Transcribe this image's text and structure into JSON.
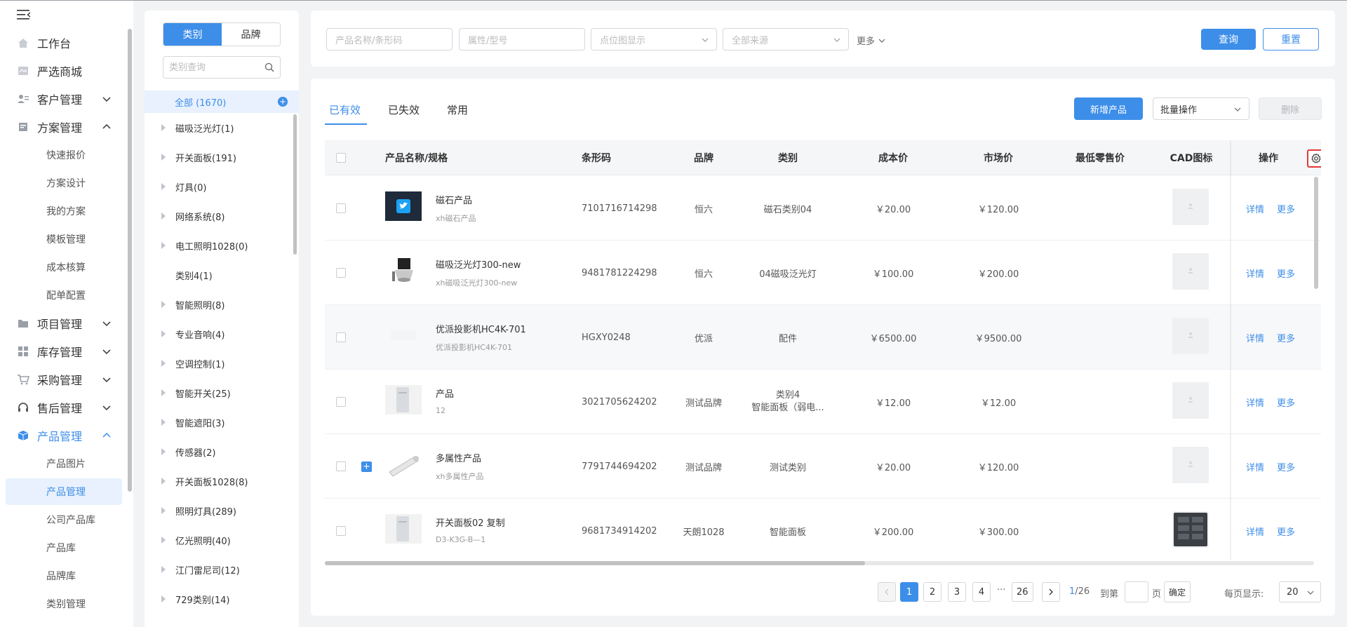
{
  "sidebar": {
    "items": [
      {
        "label": "工作台",
        "icon": "home-icon"
      },
      {
        "label": "严选商城",
        "icon": "mall-icon"
      },
      {
        "label": "客户管理",
        "icon": "customer-icon"
      },
      {
        "label": "方案管理",
        "icon": "plan-icon"
      },
      {
        "label": "项目管理",
        "icon": "folder-icon"
      },
      {
        "label": "库存管理",
        "icon": "inventory-icon"
      },
      {
        "label": "采购管理",
        "icon": "cart-icon"
      },
      {
        "label": "售后管理",
        "icon": "headset-icon"
      },
      {
        "label": "产品管理",
        "icon": "box-icon"
      }
    ],
    "plan_sub": [
      "快速报价",
      "方案设计",
      "我的方案",
      "模板管理",
      "成本核算",
      "配单配置"
    ],
    "product_sub": [
      "产品图片",
      "产品管理",
      "公司产品库",
      "产品库",
      "品牌库",
      "类别管理"
    ]
  },
  "category": {
    "tabs": [
      "类别",
      "品牌"
    ],
    "search_placeholder": "类别查询",
    "all_label": "全部 (1670)",
    "items": [
      "磁吸泛光灯(1)",
      "开关面板(191)",
      "灯具(0)",
      "网络系统(8)",
      "电工照明1028(0)",
      "类别4(1)",
      "智能照明(8)",
      "专业音响(4)",
      "空调控制(1)",
      "智能开关(25)",
      "智能遮阳(3)",
      "传感器(2)",
      "开关面板1028(8)",
      "照明灯具(289)",
      "亿光照明(40)",
      "江门雷尼司(12)",
      "729类别(14)"
    ]
  },
  "filters": {
    "name_placeholder": "产品名称/条形码",
    "attr_placeholder": "属性/型号",
    "display_placeholder": "点位图显示",
    "source_placeholder": "全部来源",
    "more_label": "更多",
    "query_label": "查询",
    "reset_label": "重置"
  },
  "main": {
    "tabs": [
      "已有效",
      "已失效",
      "常用"
    ],
    "add_label": "新增产品",
    "bulk_label": "批量操作",
    "delete_label": "删除"
  },
  "table": {
    "columns": [
      "产品名称/规格",
      "条形码",
      "品牌",
      "类别",
      "成本价",
      "市场价",
      "最低零售价",
      "CAD图标",
      "操作"
    ],
    "rows": [
      {
        "name": "磁石产品",
        "spec": "xh磁石产品",
        "barcode": "7101716714298",
        "brand": "恒六",
        "cat1": "磁石类别04",
        "cat2": "",
        "cost": "￥20.00",
        "market": "￥120.00",
        "img": "twitter-tile"
      },
      {
        "name": "磁吸泛光灯300-new",
        "spec": "xh磁吸泛光灯300-new",
        "barcode": "9481781224298",
        "brand": "恒六",
        "cat1": "04磁吸泛光灯",
        "cat2": "",
        "cost": "￥100.00",
        "market": "￥200.00",
        "img": "spotlight"
      },
      {
        "name": "优派投影机HC4K-701",
        "spec": "优派投影机HC4K-701",
        "barcode": "HGXY0248",
        "brand": "优派",
        "cat1": "配件",
        "cat2": "",
        "cost": "￥6500.00",
        "market": "￥9500.00",
        "img": "blank"
      },
      {
        "name": "产品",
        "spec": "12",
        "barcode": "3021705624202",
        "brand": "测试品牌",
        "cat1": "类别4",
        "cat2": "智能面板（弱电...",
        "cost": "￥12.00",
        "market": "￥12.00",
        "img": "panel"
      },
      {
        "name": "多属性产品",
        "spec": "xh多属性产品",
        "barcode": "7791744694202",
        "brand": "测试品牌",
        "cat1": "测试类别",
        "cat2": "",
        "cost": "￥20.00",
        "market": "￥120.00",
        "img": "tube"
      },
      {
        "name": "开关面板02 复制",
        "spec": "D3-K3G-B—1",
        "barcode": "9681734914202",
        "brand": "天朗1028",
        "cat1": "智能面板",
        "cat2": "",
        "cost": "￥200.00",
        "market": "￥300.00",
        "img": "panel"
      }
    ],
    "detail_label": "详情",
    "more_label": "更多"
  },
  "pagination": {
    "pages": [
      "1",
      "2",
      "3",
      "4",
      "26"
    ],
    "ellipsis": "···",
    "current": "1",
    "total": "/26",
    "goto_label": "到第",
    "page_unit": "页",
    "confirm_label": "确定",
    "per_page_label": "每页显示:",
    "per_page_value": "20"
  },
  "colors": {
    "accent": "#3d8ee9",
    "highlight": "#e53935"
  }
}
